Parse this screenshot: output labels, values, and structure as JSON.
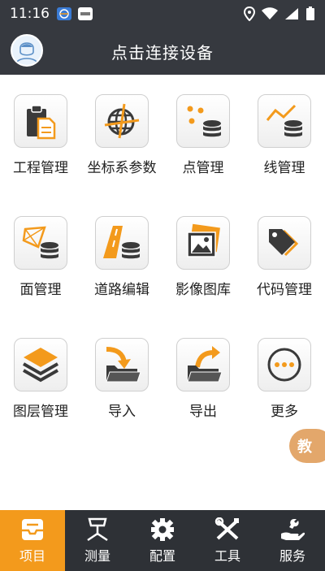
{
  "status_bar": {
    "time": "11:16",
    "notification_icons": [
      "app-icon",
      "hms-icon"
    ],
    "right_icons": [
      "location-icon",
      "wifi-icon",
      "signal-icon",
      "battery-icon"
    ]
  },
  "header": {
    "title": "点击连接设备",
    "avatar_icon": "user-avatar-icon"
  },
  "grid": {
    "items": [
      {
        "label": "工程管理",
        "icon": "project-clipboard-icon"
      },
      {
        "label": "坐标系参数",
        "icon": "coordinate-globe-icon"
      },
      {
        "label": "点管理",
        "icon": "point-database-icon"
      },
      {
        "label": "线管理",
        "icon": "line-database-icon"
      },
      {
        "label": "面管理",
        "icon": "surface-database-icon"
      },
      {
        "label": "道路编辑",
        "icon": "road-edit-icon"
      },
      {
        "label": "影像图库",
        "icon": "image-gallery-icon"
      },
      {
        "label": "代码管理",
        "icon": "code-tag-icon"
      },
      {
        "label": "图层管理",
        "icon": "layers-icon"
      },
      {
        "label": "导入",
        "icon": "import-folder-icon"
      },
      {
        "label": "导出",
        "icon": "export-folder-icon"
      },
      {
        "label": "更多",
        "icon": "more-icon"
      }
    ]
  },
  "float_button": {
    "label": "教"
  },
  "bottom_nav": {
    "active_index": 0,
    "tabs": [
      {
        "label": "项目",
        "icon": "project-tray-icon"
      },
      {
        "label": "测量",
        "icon": "survey-instrument-icon"
      },
      {
        "label": "配置",
        "icon": "gear-icon"
      },
      {
        "label": "工具",
        "icon": "tools-icon"
      },
      {
        "label": "服务",
        "icon": "service-hand-icon"
      }
    ]
  },
  "colors": {
    "accent": "#f39a1c",
    "bar_bg": "#36393f",
    "icon_orange": "#f39a1c",
    "icon_dark": "#3a3a3a"
  }
}
